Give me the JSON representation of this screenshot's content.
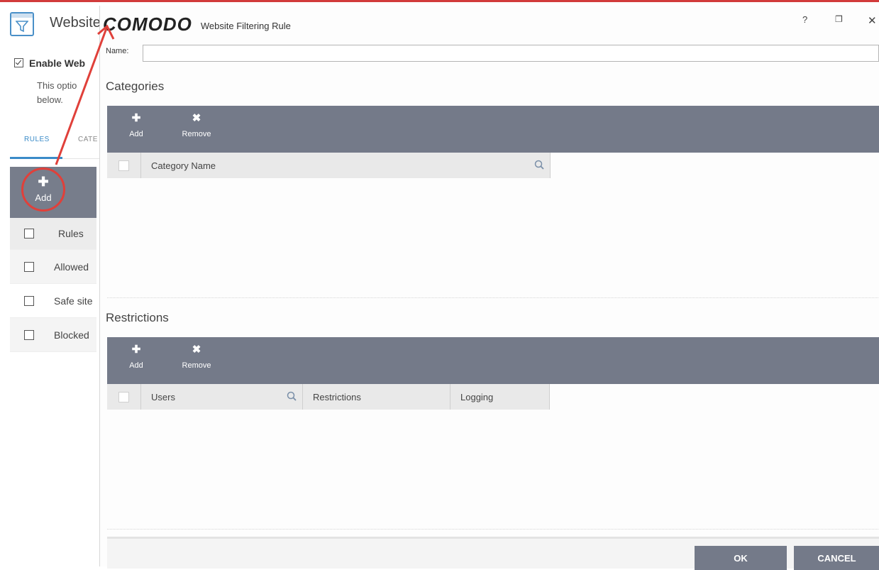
{
  "background_window": {
    "title": "Website",
    "enable_label": "Enable Web",
    "description": [
      "This optio",
      "below."
    ],
    "tabs": [
      {
        "label": "RULES",
        "active": true
      },
      {
        "label": "CATE",
        "active": false
      }
    ],
    "toolbar": {
      "add_label": "Add"
    },
    "table": {
      "header": "Rules",
      "rows": [
        "Allowed",
        "Safe site",
        "Blocked"
      ]
    }
  },
  "dialog": {
    "brand": "COMODO",
    "title": "Website Filtering Rule",
    "controls": {
      "help": "?",
      "restore": "❐",
      "close": "✕"
    },
    "name_label": "Name:",
    "name_value": "",
    "categories": {
      "title": "Categories",
      "add_label": "Add",
      "remove_label": "Remove",
      "columns": [
        "Category Name"
      ]
    },
    "restrictions": {
      "title": "Restrictions",
      "add_label": "Add",
      "remove_label": "Remove",
      "columns": [
        "Users",
        "Restrictions",
        "Logging"
      ]
    },
    "ok_label": "OK",
    "cancel_label": "CANCEL"
  },
  "colors": {
    "toolbar": "#747a89",
    "accent_blue": "#3a8bc8",
    "highlight_red": "#e0403a"
  },
  "icons": [
    "filter-icon",
    "plus-icon",
    "remove-icon",
    "search-icon",
    "help-icon",
    "restore-icon",
    "close-icon"
  ]
}
